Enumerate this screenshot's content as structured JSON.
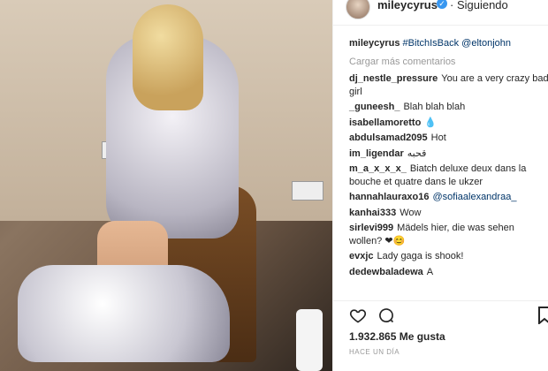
{
  "header": {
    "username": "mileycyrus",
    "follow_state": "· Siguiendo"
  },
  "caption": {
    "username": "mileycyrus",
    "text": "#BitchIsBack @eltonjohn"
  },
  "load_more": "Cargar más comentarios",
  "comments": [
    {
      "user": "dj_nestle_pressure",
      "text": "You are a very crazy bad girl"
    },
    {
      "user": "_guneesh_",
      "text": "Blah blah blah"
    },
    {
      "user": "isabellamoretto",
      "text": "💧"
    },
    {
      "user": "abdulsamad2095",
      "text": "Hot"
    },
    {
      "user": "im_ligendar",
      "text": "قحبه"
    },
    {
      "user": "m_a_x_x_x_",
      "text": "Biatch deluxe deux dans la bouche et quatre dans le ukzer"
    },
    {
      "user": "hannahlauraxo16",
      "text": "@sofiaalexandraa_"
    },
    {
      "user": "kanhai333",
      "text": "Wow"
    },
    {
      "user": "sirlevi999",
      "text": "Mädels hier, die was sehen wollen? ❤😊"
    },
    {
      "user": "evxjc",
      "text": "Lady gaga is shook!"
    },
    {
      "user": "dedewbaladewa",
      "text": "A"
    }
  ],
  "likes": "1.932.865 Me gusta",
  "timestamp": "HACE UN DÍA",
  "icons": {
    "like": "heart-icon",
    "comment": "comment-icon",
    "save": "bookmark-icon"
  }
}
